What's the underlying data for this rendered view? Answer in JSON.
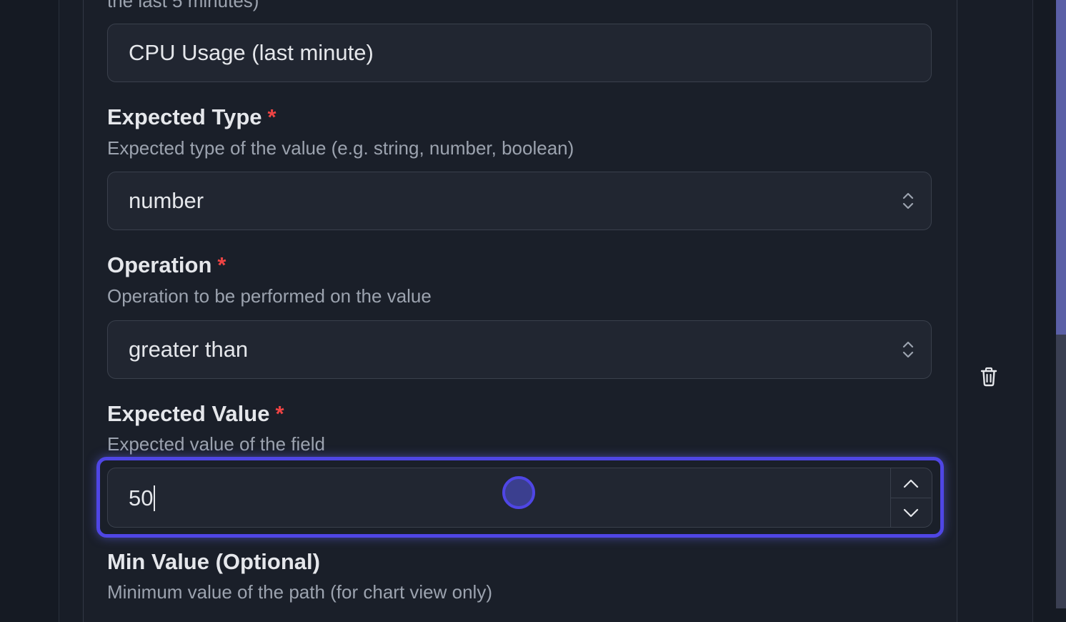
{
  "top_cut_text": "the last 5 minutes)",
  "name_field": {
    "value": "CPU Usage (last minute)"
  },
  "expected_type": {
    "label": "Expected Type",
    "required_mark": "*",
    "description": "Expected type of the value (e.g. string, number, boolean)",
    "selected": "number"
  },
  "operation": {
    "label": "Operation",
    "required_mark": "*",
    "description": "Operation to be performed on the value",
    "selected": "greater than"
  },
  "expected_value": {
    "label": "Expected Value",
    "required_mark": "*",
    "description": "Expected value of the field",
    "value": "50"
  },
  "min_value": {
    "label": "Min Value (Optional)",
    "description": "Minimum value of the path (for chart view only)"
  },
  "colors": {
    "focus_ring": "#4f46e5",
    "required": "#ef4444",
    "scrollbar_thumb": "#5a5fa6"
  },
  "icons": [
    "select-arrows-icon",
    "chevron-up-icon",
    "chevron-down-icon",
    "trash-icon"
  ]
}
